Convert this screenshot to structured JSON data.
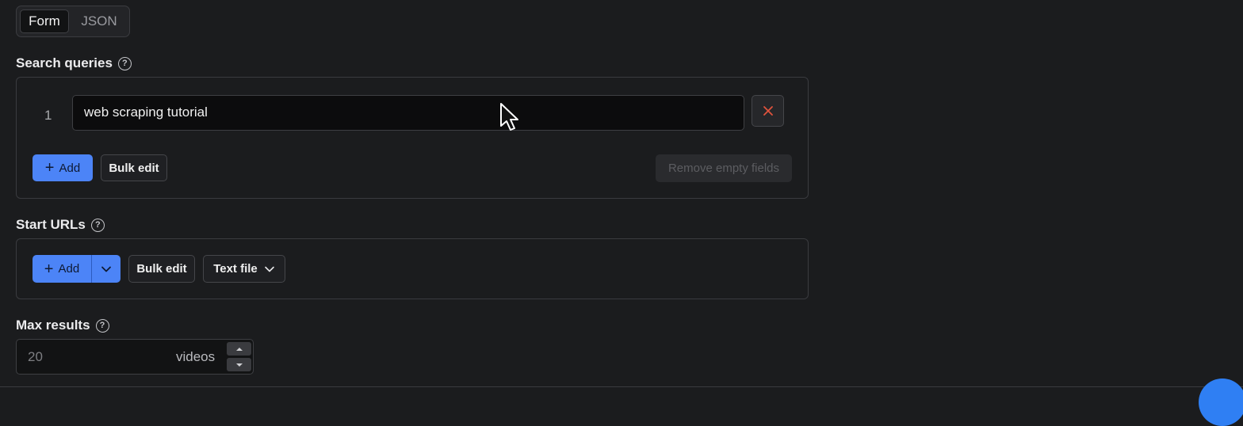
{
  "mode_toggle": {
    "form_label": "Form",
    "json_label": "JSON",
    "active": "Form"
  },
  "search_queries": {
    "label": "Search queries",
    "help_icon": "question-circle-icon",
    "items": [
      {
        "index": "1",
        "value": "web scraping tutorial"
      }
    ],
    "remove_icon": "close-x-icon",
    "add_label": "Add",
    "bulk_edit_label": "Bulk edit",
    "remove_empty_label": "Remove empty fields"
  },
  "start_urls": {
    "label": "Start URLs",
    "help_icon": "question-circle-icon",
    "add_label": "Add",
    "bulk_edit_label": "Bulk edit",
    "text_file_label": "Text file"
  },
  "max_results": {
    "label": "Max results",
    "help_icon": "question-circle-icon",
    "placeholder": "20",
    "unit": "videos"
  },
  "colors": {
    "background": "#1b1c1e",
    "primary": "#4c84f7",
    "danger_icon": "#e0533d"
  }
}
